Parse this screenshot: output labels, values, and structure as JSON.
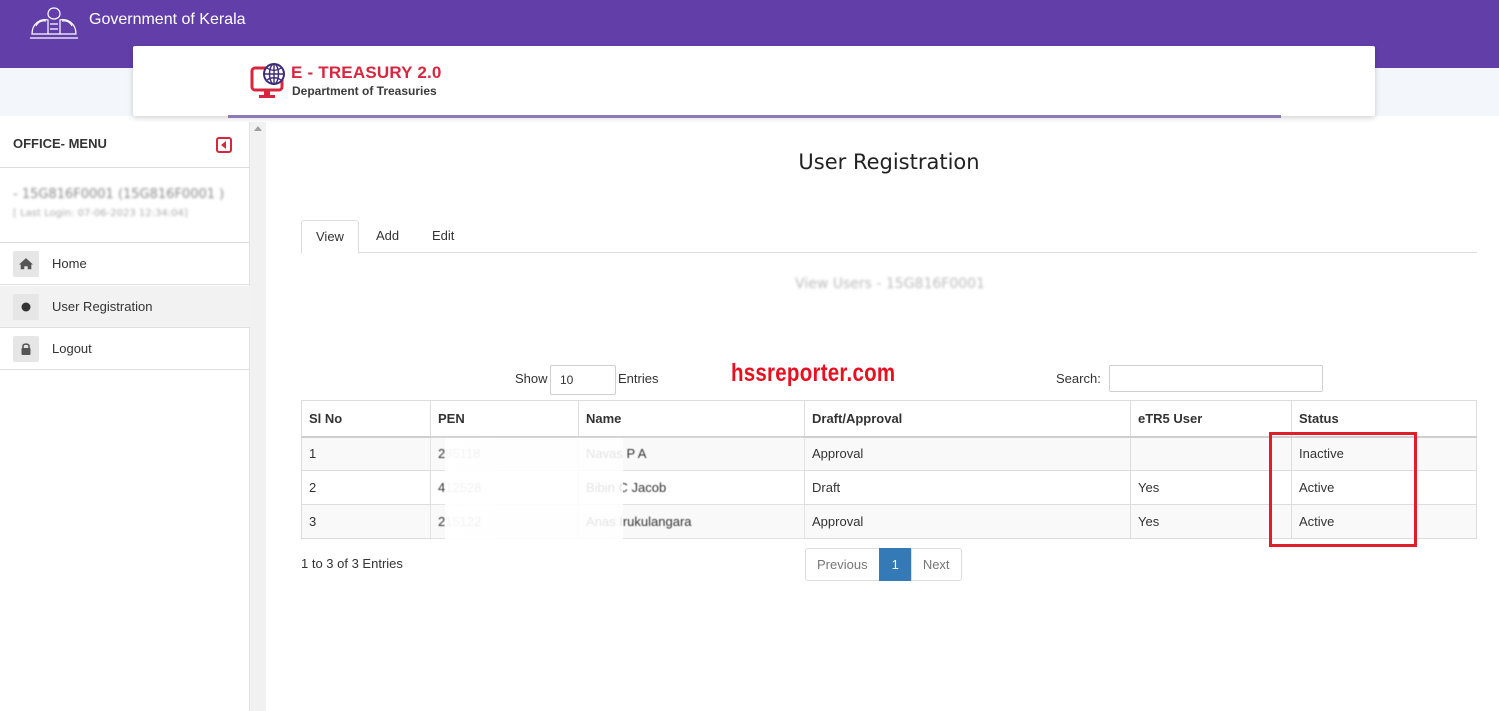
{
  "header": {
    "gov_title": "Government of Kerala",
    "logo_title": "E - TREASURY 2.0",
    "logo_subtitle": "Department of Treasuries",
    "brand_color": "#623ea8",
    "accent_color": "#d9263f"
  },
  "sidebar": {
    "title": "OFFICE- MENU",
    "office_code": "- 15G816F0001 (15G816F0001 )",
    "last_login": "[ Last Login: 07-06-2023 12:34:04]",
    "items": [
      {
        "label": "Home",
        "icon": "home-icon"
      },
      {
        "label": "User Registration",
        "icon": "circle-icon"
      },
      {
        "label": "Logout",
        "icon": "lock-icon"
      }
    ]
  },
  "main": {
    "title": "User Registration",
    "tabs": [
      {
        "label": "View"
      },
      {
        "label": "Add"
      },
      {
        "label": "Edit"
      }
    ],
    "subheading": "View Users - 15G816F0001",
    "show_label": "Show",
    "entries_value": "10",
    "entries_label": "Entries",
    "watermark": "hssreporter.com",
    "search_label": "Search:",
    "search_value": "",
    "table": {
      "columns": [
        "Sl No",
        "PEN",
        "Name",
        "Draft/Approval",
        "eTR5 User",
        "Status"
      ],
      "rows": [
        {
          "sl": "1",
          "pen": "285118",
          "name": "Navas P A",
          "approval": "Approval",
          "etr5": "",
          "status": "Inactive"
        },
        {
          "sl": "2",
          "pen": "412528",
          "name": "Bibin C Jacob",
          "approval": "Draft",
          "etr5": "Yes",
          "status": "Active"
        },
        {
          "sl": "3",
          "pen": "215122",
          "name": "Anas Irukulangara",
          "approval": "Approval",
          "etr5": "Yes",
          "status": "Active"
        }
      ]
    },
    "info": "1 to 3 of 3 Entries",
    "pagination": {
      "previous": "Previous",
      "current": "1",
      "next": "Next"
    }
  }
}
